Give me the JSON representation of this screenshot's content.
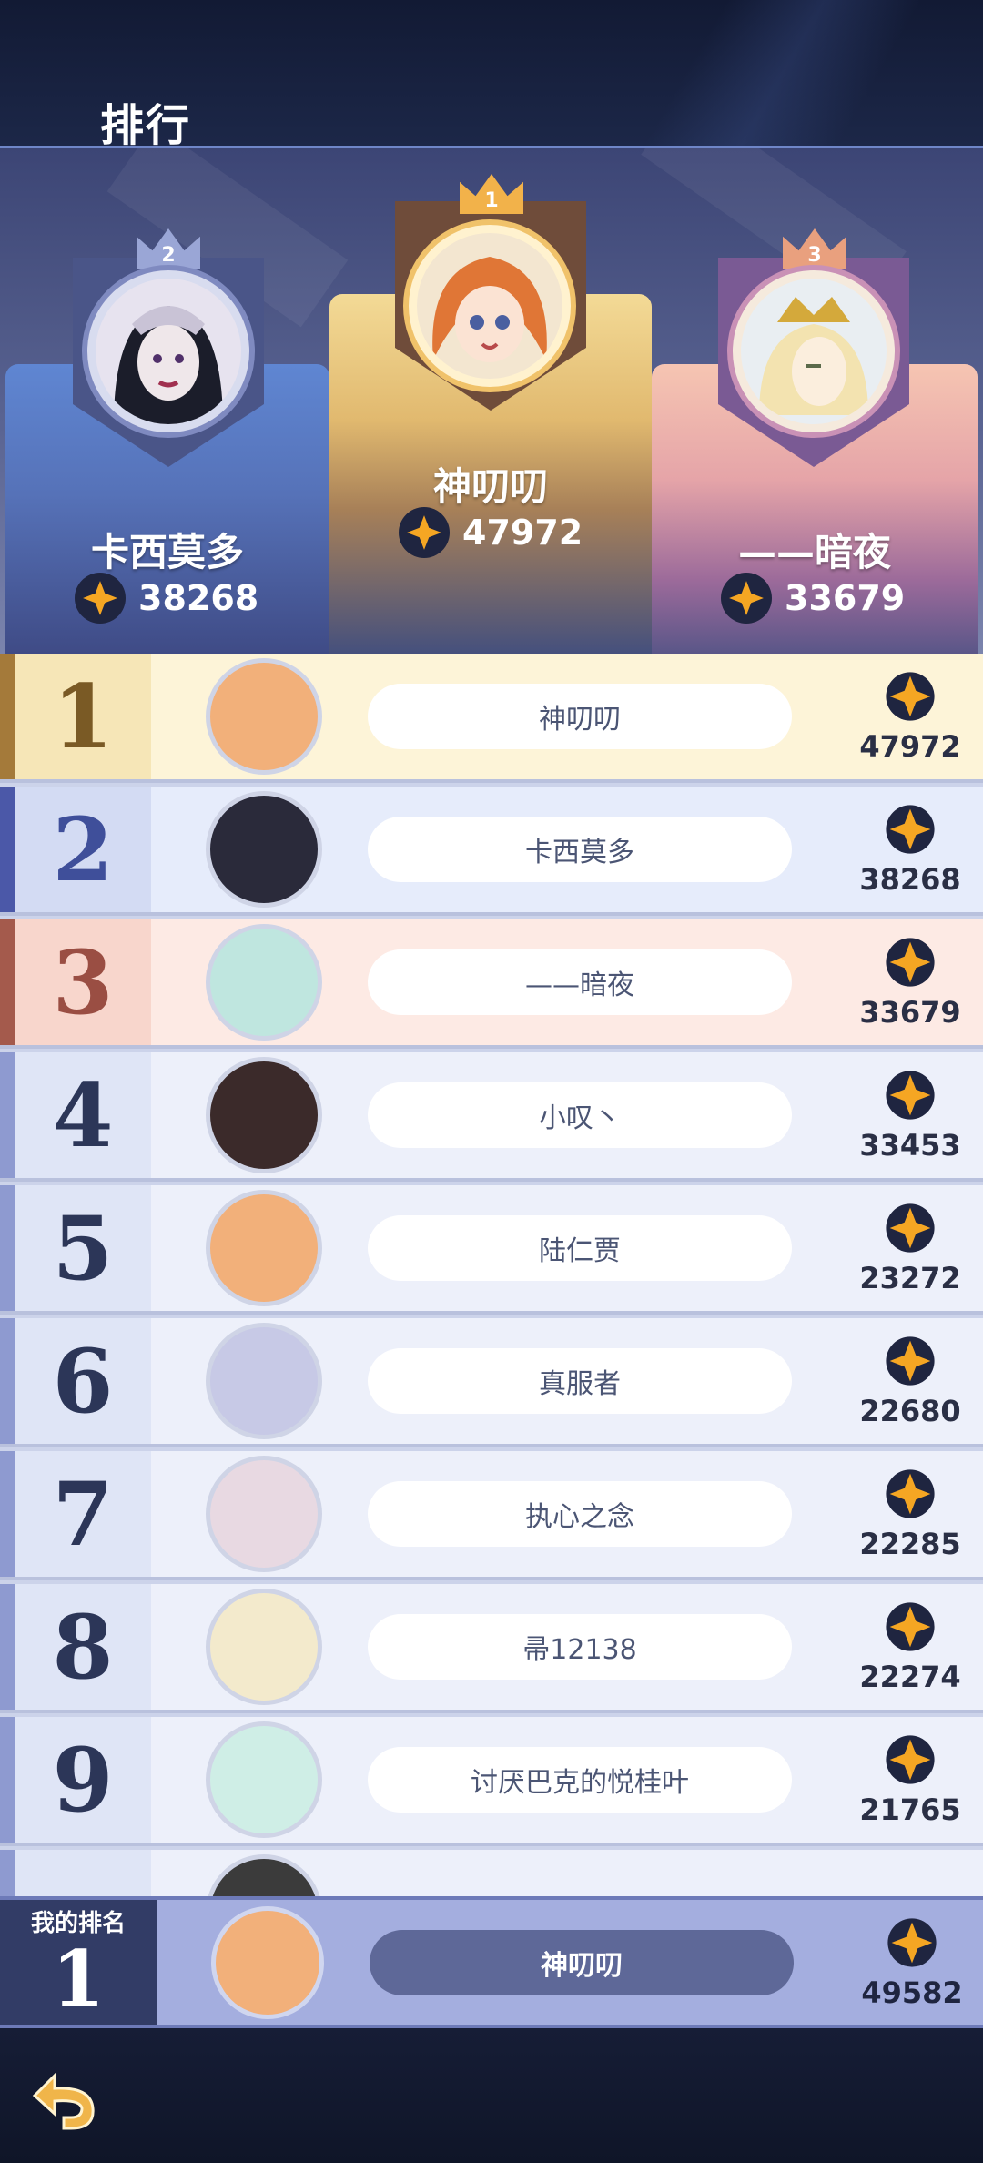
{
  "header": {
    "title": "排行"
  },
  "colors": {
    "gem_fill": "#f5a623",
    "gem_bg": "#1f2540",
    "rank1": "#7a5a25",
    "rank2": "#3f4f9a",
    "rank3": "#9a4e43",
    "rank_other": "#2c3658"
  },
  "podium": [
    {
      "place": "2",
      "name": "卡西莫多",
      "score": "38268"
    },
    {
      "place": "1",
      "name": "神叨叨",
      "score": "47972"
    },
    {
      "place": "3",
      "name": "——暗夜",
      "score": "33679"
    }
  ],
  "rows": [
    {
      "rank": "1",
      "name": "神叨叨",
      "score": "47972"
    },
    {
      "rank": "2",
      "name": "卡西莫多",
      "score": "38268"
    },
    {
      "rank": "3",
      "name": "——暗夜",
      "score": "33679"
    },
    {
      "rank": "4",
      "name": "小叹丶",
      "score": "33453"
    },
    {
      "rank": "5",
      "name": "陆仁贾",
      "score": "23272"
    },
    {
      "rank": "6",
      "name": "真服者",
      "score": "22680"
    },
    {
      "rank": "7",
      "name": "执心之念",
      "score": "22285"
    },
    {
      "rank": "8",
      "name": "帚12138",
      "score": "22274"
    },
    {
      "rank": "9",
      "name": "讨厌巴克的悦桂叶",
      "score": "21765"
    }
  ],
  "my_rank": {
    "label": "我的排名",
    "rank": "1",
    "name": "神叨叨",
    "score": "49582"
  },
  "icons": {
    "gem": "star-gem-icon",
    "back": "back-arrow-icon"
  }
}
